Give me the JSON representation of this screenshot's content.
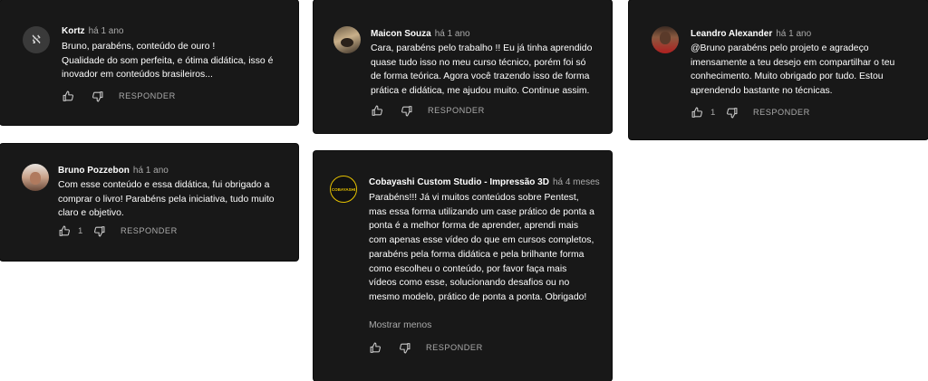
{
  "comments": [
    {
      "author": "Kortz",
      "time": "há 1 ano",
      "text": "Bruno, parabéns, conteúdo de ouro !\nQualidade do som perfeita, e ótima didática, isso é inovador em conteúdos brasileiros...",
      "likes": "",
      "reply_label": "RESPONDER",
      "avatar_letter": "ℵ"
    },
    {
      "author": "Maicon Souza",
      "time": "há 1 ano",
      "text": "Cara, parabéns pelo trabalho !! Eu já tinha aprendido quase tudo isso no meu curso técnico, porém foi só de forma teórica. Agora você trazendo isso de forma prática e didática, me ajudou muito. Continue assim.",
      "likes": "",
      "reply_label": "RESPONDER"
    },
    {
      "author": "Leandro Alexander",
      "time": "há 1 ano",
      "text": "@Bruno parabéns pelo projeto e agradeço imensamente a teu desejo em compartilhar o teu conhecimento. Muito obrigado por tudo. Estou aprendendo bastante no técnicas.",
      "likes": "1",
      "reply_label": "RESPONDER"
    },
    {
      "author": "Bruno Pozzebon",
      "time": "há 1 ano",
      "text": "Com esse conteúdo e essa didática, fui obrigado a comprar o livro! Parabéns pela iniciativa, tudo muito claro e objetivo.",
      "likes": "1",
      "reply_label": "RESPONDER"
    },
    {
      "author": "Cobayashi Custom Studio - Impressão 3D",
      "time": "há 4 meses",
      "text": "Parabéns!!! Já vi muitos conteúdos sobre Pentest, mas essa forma utilizando um case prático de ponta a ponta é a melhor forma de aprender, aprendi mais com apenas esse vídeo do que em cursos completos, parabéns pela forma didática e pela brilhante forma como escolheu o conteúdo, por favor faça mais vídeos como esse, solucionando desafios ou no mesmo modelo, prático de ponta a ponta. Obrigado!",
      "likes": "",
      "reply_label": "RESPONDER",
      "show_less": "Mostrar menos",
      "avatar_text": "COBAYASHI"
    }
  ]
}
